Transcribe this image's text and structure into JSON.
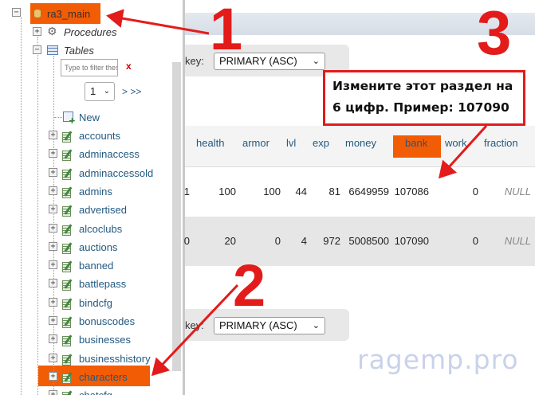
{
  "navigation": {
    "database": "ra3_main",
    "procedures_label": "Procedures",
    "tables_label": "Tables",
    "filter_placeholder": "Type to filter these",
    "filter_clear": "x",
    "page_select": "1",
    "page_next": "> >>",
    "new_label": "New",
    "tables": [
      "accounts",
      "adminaccess",
      "adminaccessold",
      "admins",
      "advertised",
      "alcoclubs",
      "auctions",
      "banned",
      "battlepass",
      "bindcfg",
      "bonuscodes",
      "businesses",
      "businesshistory",
      "characters",
      "chatcfg"
    ]
  },
  "sort": {
    "label_fragment": "key:",
    "top_value": "PRIMARY (ASC)",
    "bottom_value": "PRIMARY (ASC)"
  },
  "table": {
    "columns": [
      "health",
      "armor",
      "lvl",
      "exp",
      "money",
      "bank",
      "work",
      "fraction"
    ],
    "rows": [
      {
        "id_tail": "1",
        "health": "100",
        "armor": "100",
        "lvl": "44",
        "exp": "81",
        "money": "6649959",
        "bank": "107086",
        "work": "0",
        "fraction": "NULL"
      },
      {
        "id_tail": "0",
        "health": "20",
        "armor": "0",
        "lvl": "4",
        "exp": "972",
        "money": "5008500",
        "bank": "107090",
        "work": "0",
        "fraction": "NULL"
      }
    ]
  },
  "annotation": {
    "line1": "Измените этот раздел на",
    "line2": "6 цифр. Пример: 107090",
    "step1": "1",
    "step2": "2",
    "step3": "3"
  },
  "watermark": "ragemp.pro",
  "colors": {
    "highlight": "#f25c05",
    "annotation_red": "#e31b1b",
    "link_blue": "#235a81"
  }
}
